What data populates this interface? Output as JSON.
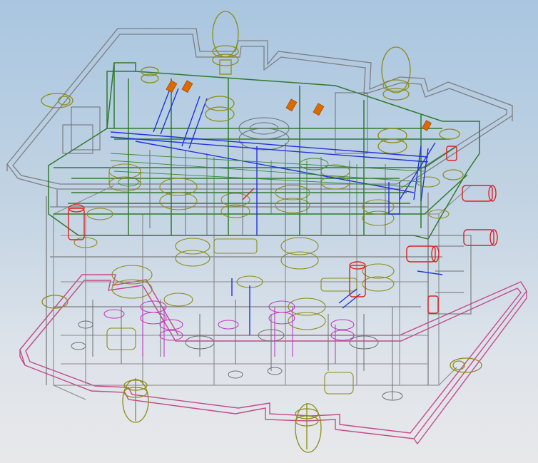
{
  "viewport": {
    "background_top": "#a9c6e0",
    "background_bottom": "#e8e8ea"
  },
  "model_colors": {
    "top_plate": "#7e7e80",
    "bottom_plate": "#c44a8c",
    "frame_green": "#2f7a2f",
    "lifting_eyes": "#8c8c18",
    "cooling_blue": "#2233dd",
    "fittings_red": "#dd2222",
    "fittings_orange": "#dd6a00",
    "bolts_magenta": "#c23cc2"
  }
}
